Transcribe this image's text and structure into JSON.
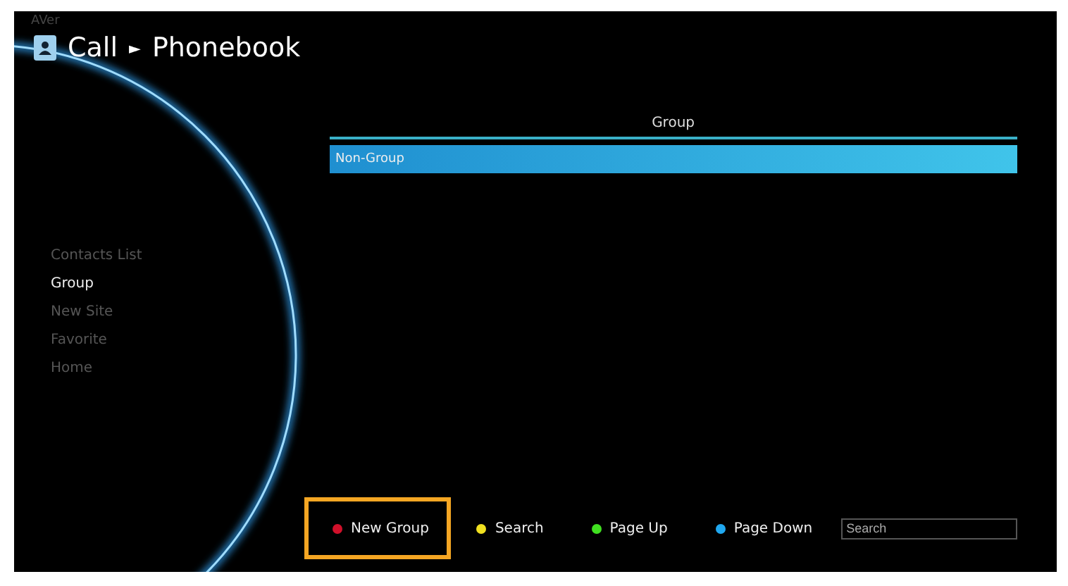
{
  "logo": "AVer",
  "breadcrumb": {
    "section": "Call",
    "separator": "►",
    "page": "Phonebook"
  },
  "sidebar": {
    "items": [
      {
        "label": "Contacts List",
        "selected": false
      },
      {
        "label": "Group",
        "selected": true
      },
      {
        "label": "New Site",
        "selected": false
      },
      {
        "label": "Favorite",
        "selected": false
      },
      {
        "label": "Home",
        "selected": false
      }
    ]
  },
  "table": {
    "columns": [
      "Group"
    ],
    "rows": [
      {
        "cells": [
          "Non-Group"
        ],
        "selected": true
      }
    ]
  },
  "actions": [
    {
      "label": "New Group",
      "color": "#d0102a",
      "highlighted": true
    },
    {
      "label": "Search",
      "color": "#f0e020",
      "highlighted": false
    },
    {
      "label": "Page Up",
      "color": "#40e020",
      "highlighted": false
    },
    {
      "label": "Page Down",
      "color": "#20a8f0",
      "highlighted": false
    }
  ],
  "search": {
    "placeholder": "Search"
  }
}
